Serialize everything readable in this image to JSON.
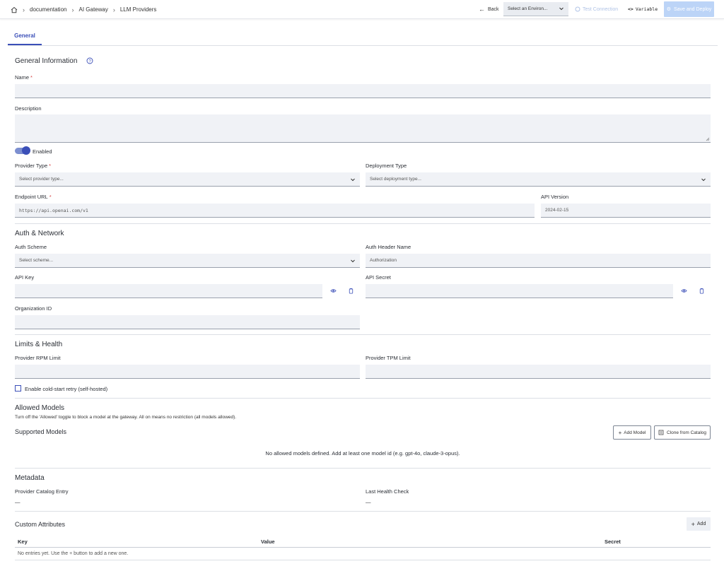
{
  "breadcrumb": {
    "items": [
      "documentation",
      "AI Gateway",
      "LLM Providers"
    ]
  },
  "toolbar": {
    "back_label": "Back",
    "environment_placeholder": "Select an Environ...",
    "test_connection_label": "Test Connection",
    "variable_label": "Variable",
    "save_label": "Save and Deploy"
  },
  "tabs": [
    "General"
  ],
  "general": {
    "title": "General Information",
    "name_label": "Name",
    "name_value": "",
    "description_label": "Description",
    "description_value": "",
    "enabled_label": "Enabled",
    "enabled": true,
    "provider_type_label": "Provider Type",
    "provider_type_placeholder": "Select provider type...",
    "deployment_type_label": "Deployment Type",
    "deployment_type_placeholder": "Select deployment type...",
    "endpoint_label": "Endpoint URL",
    "endpoint_placeholder": "https://api.openai.com/v1",
    "api_version_label": "API Version",
    "api_version_placeholder": "2024-02-15"
  },
  "auth": {
    "title": "Auth & Network",
    "scheme_label": "Auth Scheme",
    "scheme_placeholder": "Select scheme...",
    "header_label": "Auth Header Name",
    "header_placeholder": "Authorization",
    "api_key_label": "API Key",
    "api_secret_label": "API Secret",
    "org_id_label": "Organization ID"
  },
  "limits": {
    "title": "Limits & Health",
    "rpm_label": "Provider RPM Limit",
    "tpm_label": "Provider TPM Limit",
    "cold_start_label": "Enable cold-start retry (self-hosted)",
    "cold_start_checked": false
  },
  "models": {
    "title": "Allowed Models",
    "help": "Turn off the 'Allowed' toggle to block a model at the gateway. All on means no restriction (all models allowed).",
    "supported_label": "Supported Models",
    "add_model_label": "Add Model",
    "clone_label": "Clone from Catalog",
    "empty_message": "No allowed models defined. Add at least one model id (e.g. gpt-4o, claude-3-opus)."
  },
  "metadata": {
    "title": "Metadata",
    "catalog_label": "Provider Catalog Entry",
    "catalog_value": "—",
    "health_label": "Last Health Check",
    "health_value": "—"
  },
  "custom_attributes": {
    "title": "Custom Attributes",
    "add_label": "Add",
    "columns": [
      "Key",
      "Value",
      "Secret"
    ],
    "empty_message": "No entries yet. Use the + button to add a new one."
  },
  "colors": {
    "accent": "#3b4fb8",
    "required": "#d64545",
    "field_bg": "#f0f2f6",
    "save_disabled": "#bcd4f7"
  }
}
